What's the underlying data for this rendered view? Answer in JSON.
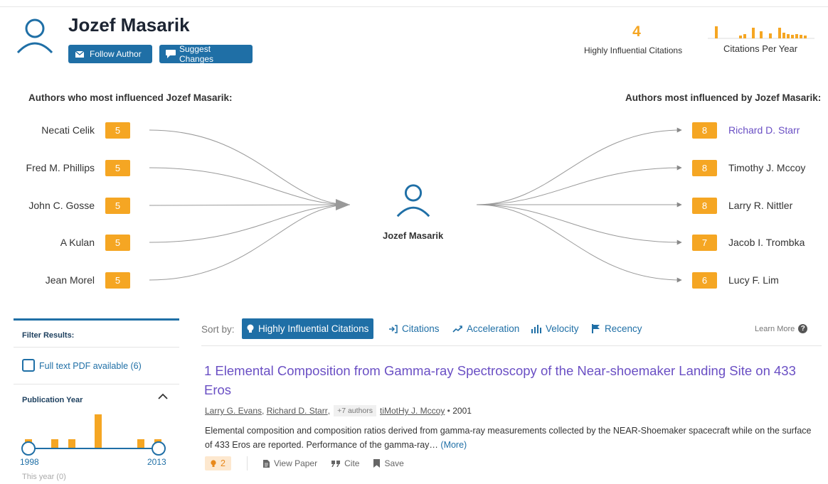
{
  "author": {
    "name": "Jozef Masarik",
    "follow_label": "Follow Author",
    "suggest_label": "Suggest Changes"
  },
  "stats": {
    "highly_influential_count": "4",
    "highly_influential_label": "Highly Influential Citations",
    "citations_per_year_label": "Citations Per Year"
  },
  "influence": {
    "left_title": "Authors who most influenced Jozef Masarik:",
    "right_title": "Authors most influenced by Jozef Masarik:",
    "center_name": "Jozef Masarik",
    "influencers": [
      {
        "name": "Necati Celik",
        "count": "5"
      },
      {
        "name": "Fred M. Phillips",
        "count": "5"
      },
      {
        "name": "John C. Gosse",
        "count": "5"
      },
      {
        "name": "A Kulan",
        "count": "5"
      },
      {
        "name": "Jean Morel",
        "count": "5"
      }
    ],
    "influenced": [
      {
        "name": "Richard D. Starr",
        "count": "8"
      },
      {
        "name": "Timothy J. Mccoy",
        "count": "8"
      },
      {
        "name": "Larry R. Nittler",
        "count": "8"
      },
      {
        "name": "Jacob I. Trombka",
        "count": "7"
      },
      {
        "name": "Lucy F. Lim",
        "count": "6"
      }
    ]
  },
  "filter": {
    "title": "Filter Results:",
    "pdf_label": "Full text PDF available (6)",
    "pub_year_title": "Publication Year",
    "year_start": "1998",
    "year_end": "2013",
    "this_year": "This year (0)"
  },
  "sort": {
    "label": "Sort by:",
    "options": [
      {
        "label": "Highly Influential Citations",
        "icon": "bulb-icon"
      },
      {
        "label": "Citations",
        "icon": "cite-arrow-icon"
      },
      {
        "label": "Acceleration",
        "icon": "trend-icon"
      },
      {
        "label": "Velocity",
        "icon": "bars-icon"
      },
      {
        "label": "Recency",
        "icon": "flag-icon"
      }
    ],
    "learn_more": "Learn More"
  },
  "paper": {
    "title": "1 Elemental Composition from Gamma-ray Spectroscopy of the Near-shoemaker Landing Site on 433 Eros",
    "authors": [
      "Larry G. Evans",
      "Richard D. Starr"
    ],
    "more_authors": "+7 authors",
    "last_author": "tiMotHy J. Mccoy",
    "year": "2001",
    "abstract": "Elemental composition and composition ratios derived from gamma-ray measurements collected by the NEAR-Shoemaker spacecraft while on the surface of 433 Eros are reported. Performance of the gamma-ray… ",
    "more_link": "(More)",
    "hic_count": "2",
    "view_paper": "View Paper",
    "cite": "Cite",
    "save": "Save"
  },
  "colors": {
    "accent_blue": "#1f6fa6",
    "orange": "#f5a623",
    "link_purple": "#6a4fc4"
  }
}
